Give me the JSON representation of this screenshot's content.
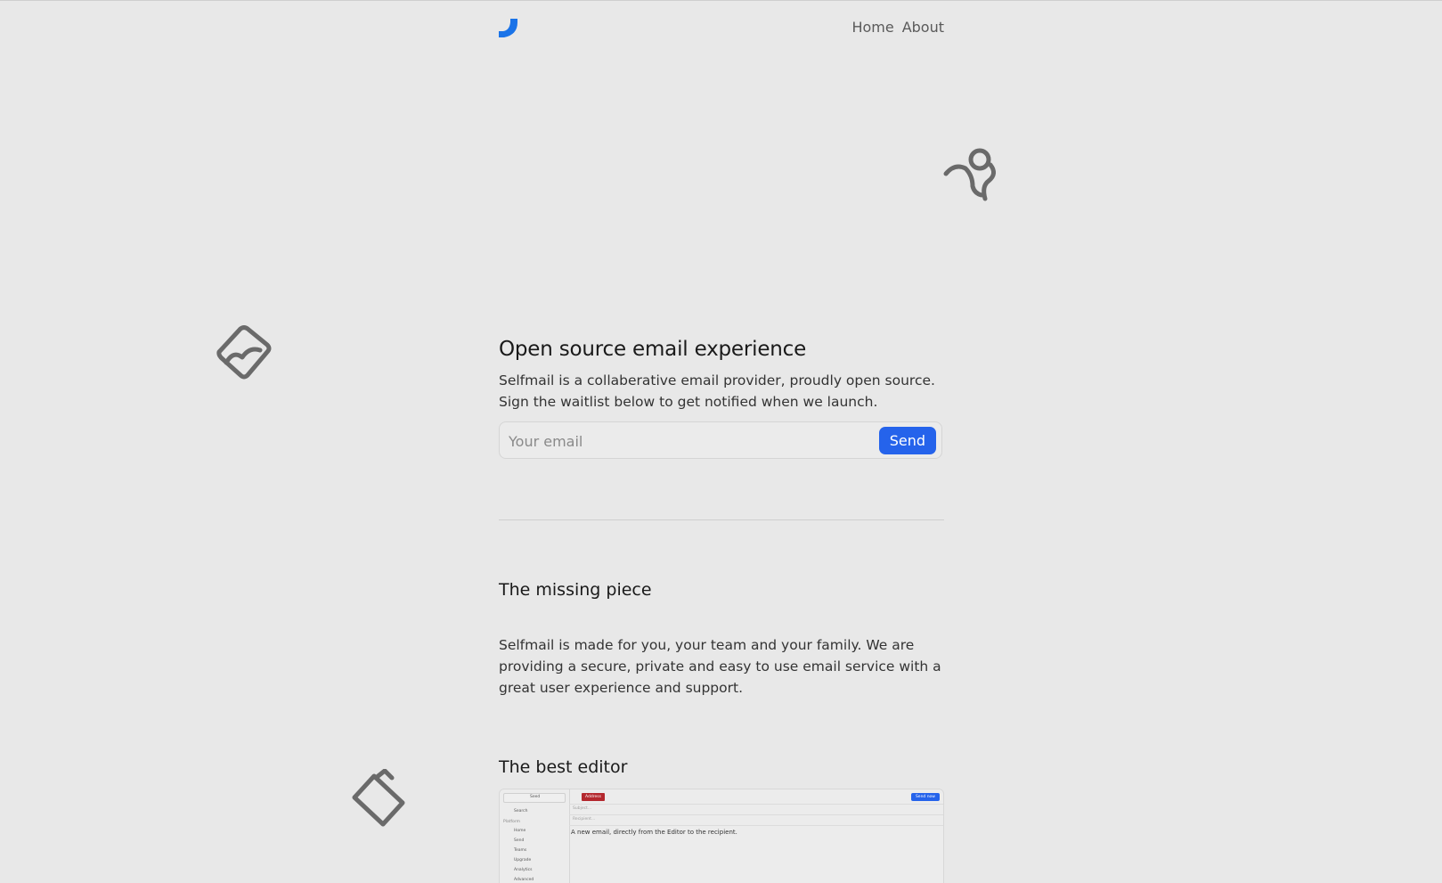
{
  "nav": {
    "links": [
      "Home",
      "About"
    ]
  },
  "hero": {
    "title": "Open source email experience",
    "description": "Selfmail is a collaberative email provider, proudly open source. Sign the waitlist below to get notified when we launch.",
    "email_placeholder": "Your email",
    "send_label": "Send"
  },
  "sections": {
    "missing_piece": {
      "title": "The missing piece",
      "body": "Selfmail is made for you, your team and your family. We are providing a secure, private and easy to use email service with a great user experience and support."
    },
    "best_editor": {
      "title": "The best editor"
    }
  },
  "editor_preview": {
    "account": "Seed",
    "search": "Search",
    "section_label": "Platform",
    "sidebar_items": [
      "Home",
      "Send",
      "Teams",
      "Upgrade",
      "Analytics",
      "Advanced"
    ],
    "tag": "Address",
    "send_button": "Send now",
    "subject_placeholder": "Subject...",
    "recipient_placeholder": "Recipient...",
    "body_text": "A new email, directly from the Editor to the recipient."
  },
  "colors": {
    "accent": "#2563eb",
    "background": "#e8e8e8",
    "icon_stroke": "#6a6a6a"
  },
  "icons": [
    "logo-icon",
    "person-doodle-icon",
    "envelope-doodle-icon",
    "wallet-doodle-icon"
  ]
}
